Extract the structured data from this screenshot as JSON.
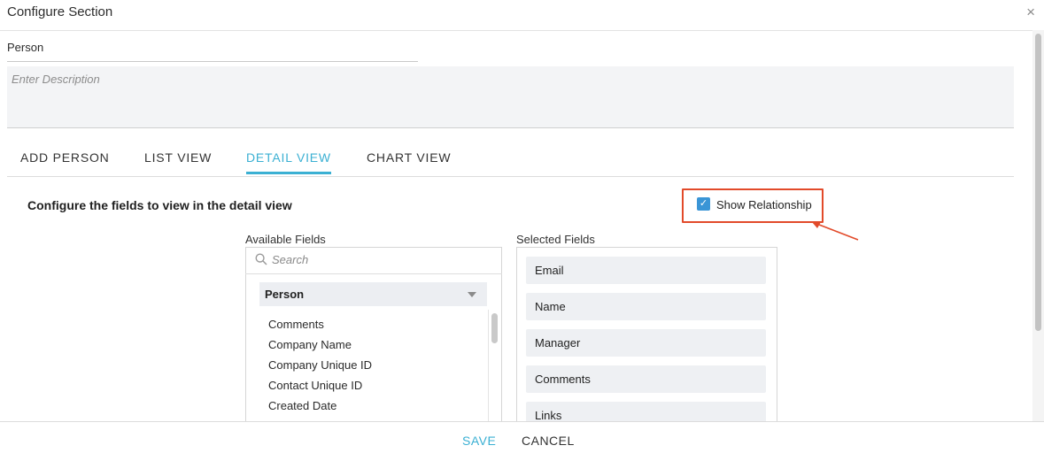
{
  "dialog": {
    "title": "Configure Section",
    "close_glyph": "×"
  },
  "section": {
    "name": "Person",
    "description_placeholder": "Enter Description"
  },
  "tabs": [
    {
      "label": "ADD PERSON",
      "active": false
    },
    {
      "label": "LIST VIEW",
      "active": false
    },
    {
      "label": "DETAIL VIEW",
      "active": true
    },
    {
      "label": "CHART VIEW",
      "active": false
    }
  ],
  "detail_view": {
    "instruction": "Configure the fields to view in the detail view",
    "show_relationship": {
      "label": "Show Relationship",
      "checked": true,
      "check_glyph": "✓"
    },
    "available": {
      "label": "Available Fields",
      "search_placeholder": "Search",
      "group": "Person",
      "items": [
        "Comments",
        "Company Name",
        "Company Unique ID",
        "Contact Unique ID",
        "Created Date"
      ]
    },
    "selected": {
      "label": "Selected Fields",
      "items": [
        "Email",
        "Name",
        "Manager",
        "Comments",
        "Links"
      ]
    }
  },
  "footer": {
    "save_label": "SAVE",
    "cancel_label": "CANCEL"
  },
  "colors": {
    "accent": "#3bb0d3",
    "checkbox": "#3a95d6",
    "highlight": "#e24a2a"
  },
  "icons": [
    "close-icon",
    "search-icon",
    "dropdown-caret-icon",
    "checkmark-icon",
    "annotation-arrow"
  ]
}
